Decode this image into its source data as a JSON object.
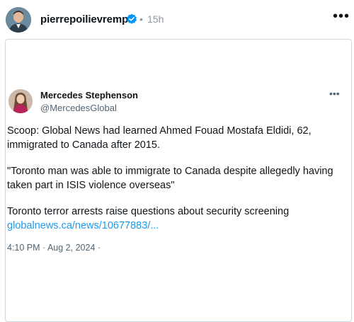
{
  "header": {
    "username": "pierrepoilievremp",
    "separator": "•",
    "time": "15h",
    "more": "•••"
  },
  "quoted": {
    "name": "Mercedes Stephenson",
    "handle": "@MercedesGlobal",
    "more": "•••",
    "paragraph1": "Scoop: Global News had learned Ahmed Fouad Mostafa Eldidi, 62, immigrated to Canada after 2015.",
    "paragraph2": "\"Toronto man was able to immigrate to Canada despite allegedly having taken part in ISIS violence overseas\"",
    "paragraph3": "Toronto terror arrests raise questions about security screening",
    "link": "globalnews.ca/news/10677883/...",
    "date": "4:10 PM · Aug 2, 2024 ·"
  },
  "colors": {
    "link": "#1d9bf0",
    "verified": "#0095f6",
    "muted": "#536471"
  },
  "icons": {
    "verified": "verified-badge-icon",
    "more": "more-horizontal-icon"
  }
}
